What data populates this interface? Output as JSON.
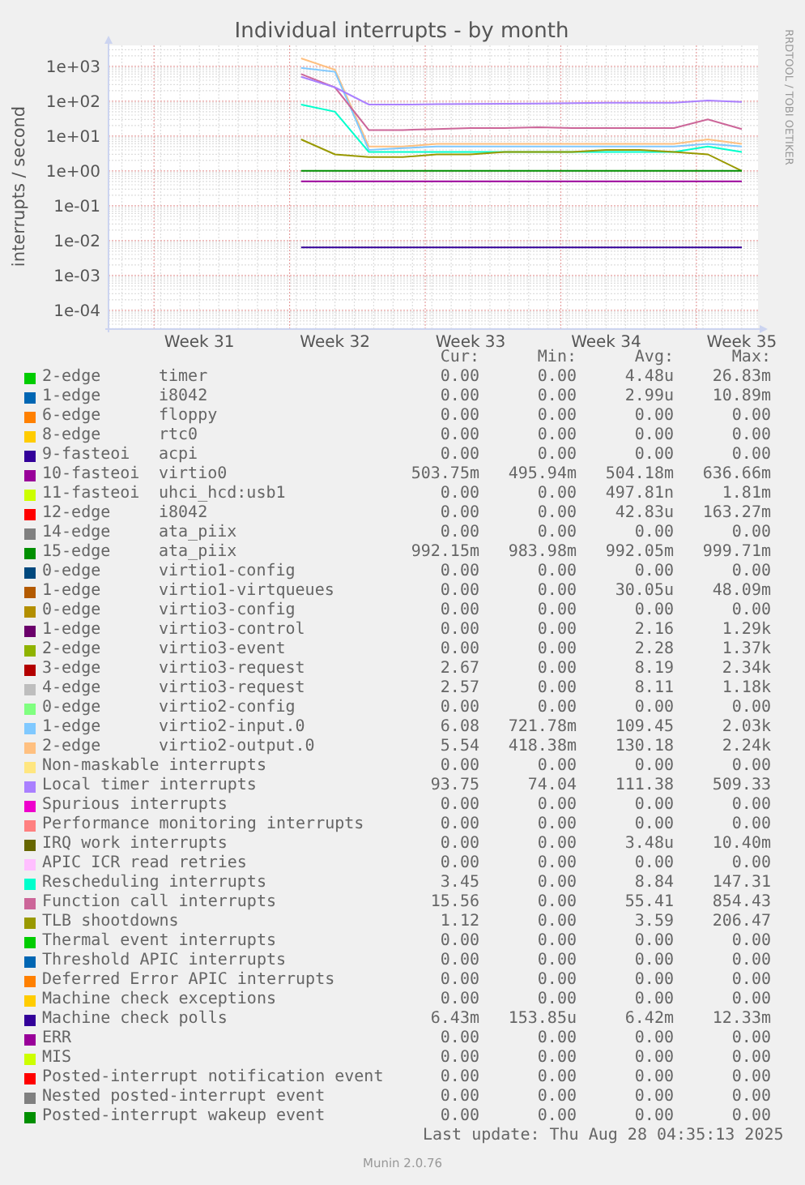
{
  "graph": {
    "title": "Individual interrupts - by month",
    "side_label": "RRDTOOL / TOBI OETIKER",
    "y_axis_title": "interrupts / second",
    "x_labels": [
      "Week 31",
      "Week 32",
      "Week 33",
      "Week 34",
      "Week 35"
    ],
    "y_labels": [
      "1e+03",
      "1e+02",
      "1e+01",
      "1e+00",
      "1e-01",
      "1e-02",
      "1e-03",
      "1e-04"
    ]
  },
  "legend": {
    "columns": [
      "Cur:",
      "Min:",
      "Avg:",
      "Max:"
    ],
    "rows": [
      {
        "color": "#00cc00",
        "name": "2-edge",
        "device": "timer",
        "cur": "0.00",
        "min": "0.00",
        "avg": "4.48u",
        "max": "26.83m"
      },
      {
        "color": "#0066b3",
        "name": "1-edge",
        "device": "i8042",
        "cur": "0.00",
        "min": "0.00",
        "avg": "2.99u",
        "max": "10.89m"
      },
      {
        "color": "#ff8000",
        "name": "6-edge",
        "device": "floppy",
        "cur": "0.00",
        "min": "0.00",
        "avg": "0.00",
        "max": "0.00"
      },
      {
        "color": "#ffcc00",
        "name": "8-edge",
        "device": "rtc0",
        "cur": "0.00",
        "min": "0.00",
        "avg": "0.00",
        "max": "0.00"
      },
      {
        "color": "#330099",
        "name": "9-fasteoi",
        "device": "acpi",
        "cur": "0.00",
        "min": "0.00",
        "avg": "0.00",
        "max": "0.00"
      },
      {
        "color": "#990099",
        "name": "10-fasteoi",
        "device": "virtio0",
        "cur": "503.75m",
        "min": "495.94m",
        "avg": "504.18m",
        "max": "636.66m"
      },
      {
        "color": "#ccff00",
        "name": "11-fasteoi",
        "device": "uhci_hcd:usb1",
        "cur": "0.00",
        "min": "0.00",
        "avg": "497.81n",
        "max": "1.81m"
      },
      {
        "color": "#ff0000",
        "name": "12-edge",
        "device": "i8042",
        "cur": "0.00",
        "min": "0.00",
        "avg": "42.83u",
        "max": "163.27m"
      },
      {
        "color": "#808080",
        "name": "14-edge",
        "device": "ata_piix",
        "cur": "0.00",
        "min": "0.00",
        "avg": "0.00",
        "max": "0.00"
      },
      {
        "color": "#008f00",
        "name": "15-edge",
        "device": "ata_piix",
        "cur": "992.15m",
        "min": "983.98m",
        "avg": "992.05m",
        "max": "999.71m"
      },
      {
        "color": "#00487d",
        "name": "0-edge",
        "device": "virtio1-config",
        "cur": "0.00",
        "min": "0.00",
        "avg": "0.00",
        "max": "0.00"
      },
      {
        "color": "#b35a00",
        "name": "1-edge",
        "device": "virtio1-virtqueues",
        "cur": "0.00",
        "min": "0.00",
        "avg": "30.05u",
        "max": "48.09m"
      },
      {
        "color": "#b38f00",
        "name": "0-edge",
        "device": "virtio3-config",
        "cur": "0.00",
        "min": "0.00",
        "avg": "0.00",
        "max": "0.00"
      },
      {
        "color": "#6b006b",
        "name": "1-edge",
        "device": "virtio3-control",
        "cur": "0.00",
        "min": "0.00",
        "avg": "2.16",
        "max": "1.29k"
      },
      {
        "color": "#8fb300",
        "name": "2-edge",
        "device": "virtio3-event",
        "cur": "0.00",
        "min": "0.00",
        "avg": "2.28",
        "max": "1.37k"
      },
      {
        "color": "#b30000",
        "name": "3-edge",
        "device": "virtio3-request",
        "cur": "2.67",
        "min": "0.00",
        "avg": "8.19",
        "max": "2.34k"
      },
      {
        "color": "#bebebe",
        "name": "4-edge",
        "device": "virtio3-request",
        "cur": "2.57",
        "min": "0.00",
        "avg": "8.11",
        "max": "1.18k"
      },
      {
        "color": "#80ff80",
        "name": "0-edge",
        "device": "virtio2-config",
        "cur": "0.00",
        "min": "0.00",
        "avg": "0.00",
        "max": "0.00"
      },
      {
        "color": "#80c9ff",
        "name": "1-edge",
        "device": "virtio2-input.0",
        "cur": "6.08",
        "min": "721.78m",
        "avg": "109.45",
        "max": "2.03k"
      },
      {
        "color": "#ffc080",
        "name": "2-edge",
        "device": "virtio2-output.0",
        "cur": "5.54",
        "min": "418.38m",
        "avg": "130.18",
        "max": "2.24k"
      },
      {
        "color": "#ffe680",
        "name": "Non-maskable interrupts",
        "cur": "0.00",
        "min": "0.00",
        "avg": "0.00",
        "max": "0.00"
      },
      {
        "color": "#aa80ff",
        "name": "Local timer interrupts",
        "cur": "93.75",
        "min": "74.04",
        "avg": "111.38",
        "max": "509.33"
      },
      {
        "color": "#ee00cc",
        "name": "Spurious interrupts",
        "cur": "0.00",
        "min": "0.00",
        "avg": "0.00",
        "max": "0.00"
      },
      {
        "color": "#ff8080",
        "name": "Performance monitoring interrupts",
        "cur": "0.00",
        "min": "0.00",
        "avg": "0.00",
        "max": "0.00"
      },
      {
        "color": "#666600",
        "name": "IRQ work interrupts",
        "cur": "0.00",
        "min": "0.00",
        "avg": "3.48u",
        "max": "10.40m"
      },
      {
        "color": "#ffbfff",
        "name": "APIC ICR read retries",
        "cur": "0.00",
        "min": "0.00",
        "avg": "0.00",
        "max": "0.00"
      },
      {
        "color": "#00ffcc",
        "name": "Rescheduling interrupts",
        "cur": "3.45",
        "min": "0.00",
        "avg": "8.84",
        "max": "147.31"
      },
      {
        "color": "#cc6699",
        "name": "Function call interrupts",
        "cur": "15.56",
        "min": "0.00",
        "avg": "55.41",
        "max": "854.43"
      },
      {
        "color": "#999900",
        "name": "TLB shootdowns",
        "cur": "1.12",
        "min": "0.00",
        "avg": "3.59",
        "max": "206.47"
      },
      {
        "color": "#00cc00",
        "name": "Thermal event interrupts",
        "cur": "0.00",
        "min": "0.00",
        "avg": "0.00",
        "max": "0.00"
      },
      {
        "color": "#0066b3",
        "name": "Threshold APIC interrupts",
        "cur": "0.00",
        "min": "0.00",
        "avg": "0.00",
        "max": "0.00"
      },
      {
        "color": "#ff8000",
        "name": "Deferred Error APIC interrupts",
        "cur": "0.00",
        "min": "0.00",
        "avg": "0.00",
        "max": "0.00"
      },
      {
        "color": "#ffcc00",
        "name": "Machine check exceptions",
        "cur": "0.00",
        "min": "0.00",
        "avg": "0.00",
        "max": "0.00"
      },
      {
        "color": "#330099",
        "name": "Machine check polls",
        "cur": "6.43m",
        "min": "153.85u",
        "avg": "6.42m",
        "max": "12.33m"
      },
      {
        "color": "#990099",
        "name": "ERR",
        "cur": "0.00",
        "min": "0.00",
        "avg": "0.00",
        "max": "0.00"
      },
      {
        "color": "#ccff00",
        "name": "MIS",
        "cur": "0.00",
        "min": "0.00",
        "avg": "0.00",
        "max": "0.00"
      },
      {
        "color": "#ff0000",
        "name": "Posted-interrupt notification event",
        "cur": "0.00",
        "min": "0.00",
        "avg": "0.00",
        "max": "0.00"
      },
      {
        "color": "#808080",
        "name": "Nested posted-interrupt event",
        "cur": "0.00",
        "min": "0.00",
        "avg": "0.00",
        "max": "0.00"
      },
      {
        "color": "#008f00",
        "name": "Posted-interrupt wakeup event",
        "cur": "0.00",
        "min": "0.00",
        "avg": "0.00",
        "max": "0.00"
      }
    ]
  },
  "last_update": "Last update: Thu Aug 28 04:35:13 2025",
  "footer": "Munin 2.0.76"
}
